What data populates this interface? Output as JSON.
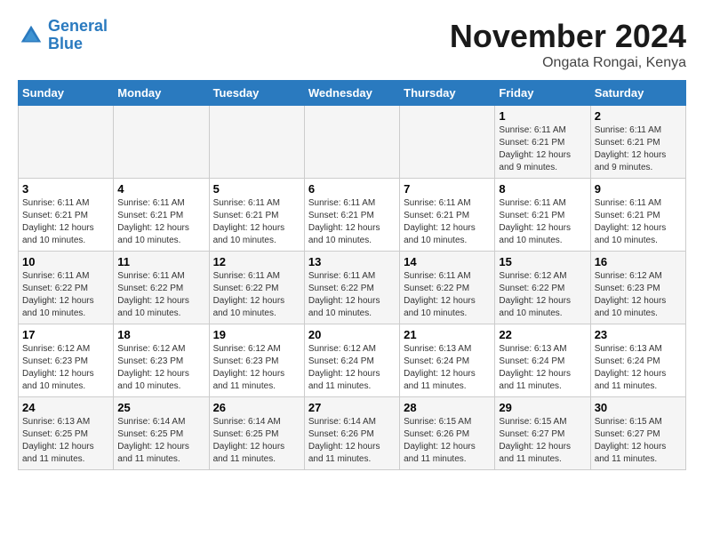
{
  "logo": {
    "line1": "General",
    "line2": "Blue"
  },
  "title": "November 2024",
  "subtitle": "Ongata Rongai, Kenya",
  "weekdays": [
    "Sunday",
    "Monday",
    "Tuesday",
    "Wednesday",
    "Thursday",
    "Friday",
    "Saturday"
  ],
  "weeks": [
    [
      {
        "day": "",
        "info": ""
      },
      {
        "day": "",
        "info": ""
      },
      {
        "day": "",
        "info": ""
      },
      {
        "day": "",
        "info": ""
      },
      {
        "day": "",
        "info": ""
      },
      {
        "day": "1",
        "info": "Sunrise: 6:11 AM\nSunset: 6:21 PM\nDaylight: 12 hours and 9 minutes."
      },
      {
        "day": "2",
        "info": "Sunrise: 6:11 AM\nSunset: 6:21 PM\nDaylight: 12 hours and 9 minutes."
      }
    ],
    [
      {
        "day": "3",
        "info": "Sunrise: 6:11 AM\nSunset: 6:21 PM\nDaylight: 12 hours and 10 minutes."
      },
      {
        "day": "4",
        "info": "Sunrise: 6:11 AM\nSunset: 6:21 PM\nDaylight: 12 hours and 10 minutes."
      },
      {
        "day": "5",
        "info": "Sunrise: 6:11 AM\nSunset: 6:21 PM\nDaylight: 12 hours and 10 minutes."
      },
      {
        "day": "6",
        "info": "Sunrise: 6:11 AM\nSunset: 6:21 PM\nDaylight: 12 hours and 10 minutes."
      },
      {
        "day": "7",
        "info": "Sunrise: 6:11 AM\nSunset: 6:21 PM\nDaylight: 12 hours and 10 minutes."
      },
      {
        "day": "8",
        "info": "Sunrise: 6:11 AM\nSunset: 6:21 PM\nDaylight: 12 hours and 10 minutes."
      },
      {
        "day": "9",
        "info": "Sunrise: 6:11 AM\nSunset: 6:21 PM\nDaylight: 12 hours and 10 minutes."
      }
    ],
    [
      {
        "day": "10",
        "info": "Sunrise: 6:11 AM\nSunset: 6:22 PM\nDaylight: 12 hours and 10 minutes."
      },
      {
        "day": "11",
        "info": "Sunrise: 6:11 AM\nSunset: 6:22 PM\nDaylight: 12 hours and 10 minutes."
      },
      {
        "day": "12",
        "info": "Sunrise: 6:11 AM\nSunset: 6:22 PM\nDaylight: 12 hours and 10 minutes."
      },
      {
        "day": "13",
        "info": "Sunrise: 6:11 AM\nSunset: 6:22 PM\nDaylight: 12 hours and 10 minutes."
      },
      {
        "day": "14",
        "info": "Sunrise: 6:11 AM\nSunset: 6:22 PM\nDaylight: 12 hours and 10 minutes."
      },
      {
        "day": "15",
        "info": "Sunrise: 6:12 AM\nSunset: 6:22 PM\nDaylight: 12 hours and 10 minutes."
      },
      {
        "day": "16",
        "info": "Sunrise: 6:12 AM\nSunset: 6:23 PM\nDaylight: 12 hours and 10 minutes."
      }
    ],
    [
      {
        "day": "17",
        "info": "Sunrise: 6:12 AM\nSunset: 6:23 PM\nDaylight: 12 hours and 10 minutes."
      },
      {
        "day": "18",
        "info": "Sunrise: 6:12 AM\nSunset: 6:23 PM\nDaylight: 12 hours and 10 minutes."
      },
      {
        "day": "19",
        "info": "Sunrise: 6:12 AM\nSunset: 6:23 PM\nDaylight: 12 hours and 11 minutes."
      },
      {
        "day": "20",
        "info": "Sunrise: 6:12 AM\nSunset: 6:24 PM\nDaylight: 12 hours and 11 minutes."
      },
      {
        "day": "21",
        "info": "Sunrise: 6:13 AM\nSunset: 6:24 PM\nDaylight: 12 hours and 11 minutes."
      },
      {
        "day": "22",
        "info": "Sunrise: 6:13 AM\nSunset: 6:24 PM\nDaylight: 12 hours and 11 minutes."
      },
      {
        "day": "23",
        "info": "Sunrise: 6:13 AM\nSunset: 6:24 PM\nDaylight: 12 hours and 11 minutes."
      }
    ],
    [
      {
        "day": "24",
        "info": "Sunrise: 6:13 AM\nSunset: 6:25 PM\nDaylight: 12 hours and 11 minutes."
      },
      {
        "day": "25",
        "info": "Sunrise: 6:14 AM\nSunset: 6:25 PM\nDaylight: 12 hours and 11 minutes."
      },
      {
        "day": "26",
        "info": "Sunrise: 6:14 AM\nSunset: 6:25 PM\nDaylight: 12 hours and 11 minutes."
      },
      {
        "day": "27",
        "info": "Sunrise: 6:14 AM\nSunset: 6:26 PM\nDaylight: 12 hours and 11 minutes."
      },
      {
        "day": "28",
        "info": "Sunrise: 6:15 AM\nSunset: 6:26 PM\nDaylight: 12 hours and 11 minutes."
      },
      {
        "day": "29",
        "info": "Sunrise: 6:15 AM\nSunset: 6:27 PM\nDaylight: 12 hours and 11 minutes."
      },
      {
        "day": "30",
        "info": "Sunrise: 6:15 AM\nSunset: 6:27 PM\nDaylight: 12 hours and 11 minutes."
      }
    ]
  ]
}
